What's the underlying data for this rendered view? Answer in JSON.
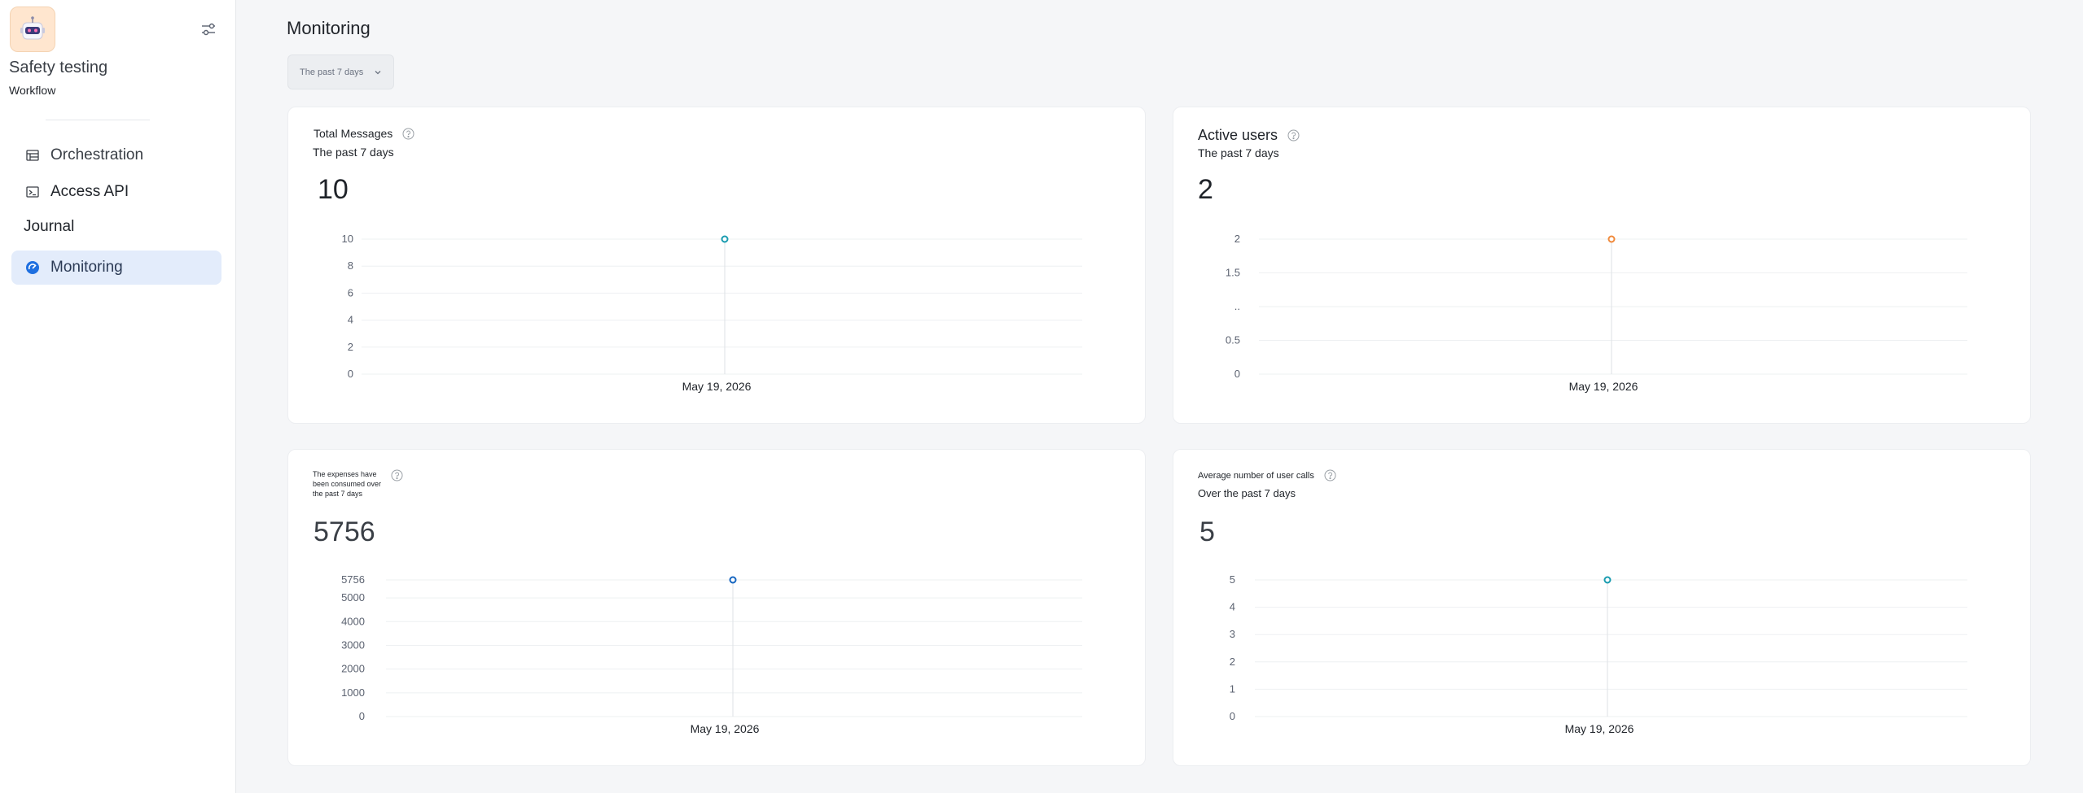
{
  "sidebar": {
    "app_name": "Safety testing",
    "app_type": "Workflow",
    "logo_icon": "robot-icon",
    "settings_icon": "sliders-icon",
    "nav": {
      "orchestration": "Orchestration",
      "access_api": "Access API",
      "journal": "Journal",
      "monitoring": "Monitoring"
    }
  },
  "header": {
    "title": "Monitoring",
    "range": "The past 7 days"
  },
  "cards": {
    "total_messages": {
      "title": "Total Messages",
      "subtitle": "The past 7 days",
      "value": "10"
    },
    "active_users": {
      "title": "Active users",
      "subtitle": "The past 7 days",
      "value": "2"
    },
    "expenses": {
      "title_line1": "The expenses have",
      "title_line2": "been consumed over",
      "title_line3": "the past 7 days",
      "value": "5756"
    },
    "avg_calls": {
      "title": "Average number of user calls",
      "subtitle": "Over the past 7 days",
      "value": "5"
    }
  },
  "colors": {
    "accent": "#1e88e5",
    "teal_point": "#1a9cb0",
    "orange_point": "#f08a3c",
    "blue_point": "#1565c0"
  },
  "chart_data": [
    {
      "type": "line",
      "x": [
        "May 19, 2026"
      ],
      "series": [
        {
          "values": [
            10
          ]
        }
      ],
      "y_ticks": [
        "0",
        "2",
        "4",
        "6",
        "8",
        "10"
      ],
      "ylim": [
        0,
        10
      ]
    },
    {
      "type": "line",
      "x": [
        "May 19, 2026"
      ],
      "series": [
        {
          "values": [
            2
          ]
        }
      ],
      "y_ticks": [
        "0",
        "0.5",
        "..",
        "1.5",
        "2"
      ],
      "ylim": [
        0,
        2
      ]
    },
    {
      "type": "line",
      "x": [
        "May 19, 2026"
      ],
      "series": [
        {
          "values": [
            5756
          ]
        }
      ],
      "y_ticks": [
        "0",
        "1000",
        "2000",
        "3000",
        "4000",
        "5000",
        "5756"
      ],
      "ylim": [
        0,
        5756
      ]
    },
    {
      "type": "line",
      "x": [
        "May 19, 2026"
      ],
      "series": [
        {
          "values": [
            5
          ]
        }
      ],
      "y_ticks": [
        "0",
        "1",
        "2",
        "3",
        "4",
        "5"
      ],
      "ylim": [
        0,
        5
      ]
    }
  ]
}
